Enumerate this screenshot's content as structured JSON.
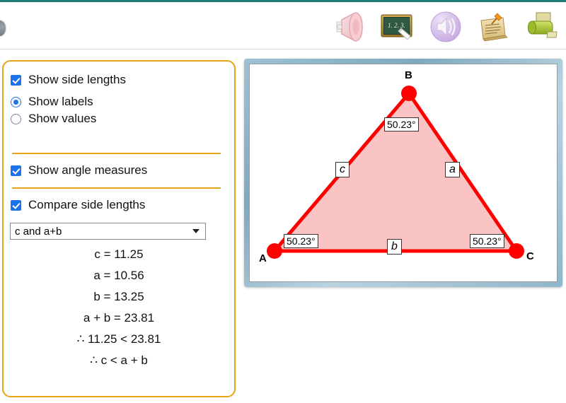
{
  "toolbar": {
    "items": [
      {
        "name": "speaker-muted-icon",
        "label": "Sound off"
      },
      {
        "name": "blackboard-icon",
        "label": "1, 2, 3."
      },
      {
        "name": "speaker-on-icon",
        "label": "Sound on"
      },
      {
        "name": "note-pin-icon",
        "label": "Notes"
      },
      {
        "name": "printer-icon",
        "label": "Print"
      }
    ]
  },
  "panel": {
    "show_side_lengths": {
      "label": "Show side lengths",
      "checked": true
    },
    "label_mode": {
      "options": [
        {
          "label": "Show labels",
          "selected": true
        },
        {
          "label": "Show values",
          "selected": false
        }
      ]
    },
    "show_angle_measures": {
      "label": "Show angle measures",
      "checked": true
    },
    "compare_side_lengths": {
      "label": "Compare side lengths",
      "checked": true
    },
    "compare_select": {
      "value": "c and a+b",
      "options": [
        "c and a+b"
      ]
    },
    "results": [
      "c = 11.25",
      "a = 10.56",
      "b = 13.25",
      "a + b = 23.81",
      "∴ 11.25 < 23.81",
      "∴ c < a + b"
    ]
  },
  "figure": {
    "vertices": [
      {
        "name": "A",
        "label": "A"
      },
      {
        "name": "B",
        "label": "B"
      },
      {
        "name": "C",
        "label": "C"
      }
    ],
    "side_labels": [
      {
        "name": "a",
        "label": "a"
      },
      {
        "name": "b",
        "label": "b"
      },
      {
        "name": "c",
        "label": "c"
      }
    ],
    "angle_labels": [
      {
        "name": "angle-B",
        "label": "50.23°"
      },
      {
        "name": "angle-A",
        "label": "50.23°"
      },
      {
        "name": "angle-C",
        "label": "50.23°"
      }
    ]
  },
  "colors": {
    "accent_orange": "#E8A317",
    "triangle_stroke": "#FF0000",
    "triangle_fill": "#FBC4C4",
    "checkbox_blue": "#1a73e8",
    "top_rule_teal": "#1f7a72"
  }
}
